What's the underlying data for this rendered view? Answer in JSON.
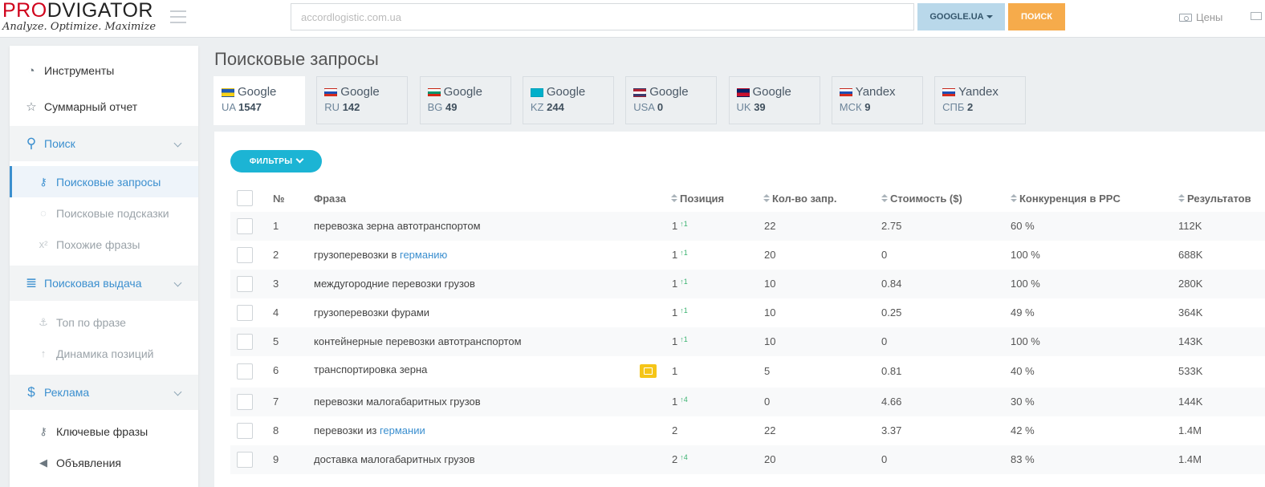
{
  "header": {
    "logo_pro": "PRO",
    "logo_rest": "DVIGATOR",
    "tagline": "Analyze. Optimize. Maximize",
    "search_value": "accordlogistic.com.ua",
    "engine_label": "GOOGLE.UA",
    "search_button": "ПОИСК",
    "prices_label": "Цены"
  },
  "sidebar": {
    "items": [
      {
        "label": "Инструменты",
        "icon": "dashboard-icon",
        "kind": "item"
      },
      {
        "label": "Суммарный отчет",
        "icon": "star-icon",
        "kind": "item"
      },
      {
        "label": "Поиск",
        "icon": "search-icon",
        "kind": "section"
      },
      {
        "label": "Поисковые запросы",
        "icon": "key-icon",
        "kind": "active"
      },
      {
        "label": "Поисковые подсказки",
        "icon": "comments-icon",
        "kind": "muted"
      },
      {
        "label": "Похожие фразы",
        "icon": "superscript-icon",
        "kind": "muted"
      },
      {
        "label": "Поисковая выдача",
        "icon": "database-icon",
        "kind": "section"
      },
      {
        "label": "Топ по фразе",
        "icon": "anchor-icon",
        "kind": "muted"
      },
      {
        "label": "Динамика позиций",
        "icon": "arrow-up-icon",
        "kind": "muted"
      },
      {
        "label": "Реклама",
        "icon": "dollar-icon",
        "kind": "section"
      },
      {
        "label": "Ключевые фразы",
        "icon": "key-icon",
        "kind": "sub"
      },
      {
        "label": "Объявления",
        "icon": "bullhorn-icon",
        "kind": "sub"
      }
    ]
  },
  "main": {
    "title": "Поисковые запросы",
    "tabs": [
      {
        "engine": "Google",
        "region": "UA",
        "count": "1547",
        "flag": [
          "#1e5bb8",
          "#f7d117"
        ]
      },
      {
        "engine": "Google",
        "region": "RU",
        "count": "142",
        "flag": [
          "#ffffff",
          "#1d4fb5",
          "#d52b1e"
        ]
      },
      {
        "engine": "Google",
        "region": "BG",
        "count": "49",
        "flag": [
          "#ffffff",
          "#00966e",
          "#d62612"
        ]
      },
      {
        "engine": "Google",
        "region": "KZ",
        "count": "244",
        "flag": [
          "#00afca"
        ]
      },
      {
        "engine": "Google",
        "region": "USA",
        "count": "0",
        "flag": [
          "#b22234",
          "#ffffff",
          "#3c3b6e"
        ]
      },
      {
        "engine": "Google",
        "region": "UK",
        "count": "39",
        "flag": [
          "#012169",
          "#c8102e"
        ]
      },
      {
        "engine": "Yandex",
        "region": "МСК",
        "count": "9",
        "flag": [
          "#ffffff",
          "#1d4fb5",
          "#d52b1e"
        ]
      },
      {
        "engine": "Yandex",
        "region": "СПБ",
        "count": "2",
        "flag": [
          "#ffffff",
          "#1d4fb5",
          "#d52b1e"
        ]
      }
    ],
    "filter_label": "ФИЛЬТРЫ",
    "columns": {
      "num": "№",
      "phrase": "Фраза",
      "position": "Позиция",
      "volume": "Кол-во запр.",
      "cost": "Стоимость ($)",
      "competition": "Конкуренция в PPC",
      "results": "Результатов"
    },
    "rows": [
      {
        "num": "1",
        "phrase": "перевозка зерна автотранспортом",
        "phrase_link": "",
        "position": "1",
        "delta": "↑1",
        "volume": "22",
        "cost": "2.75",
        "competition": "60 %",
        "results": "112K",
        "image": false
      },
      {
        "num": "2",
        "phrase": "грузоперевозки в ",
        "phrase_link": "германию",
        "position": "1",
        "delta": "↑1",
        "volume": "20",
        "cost": "0",
        "competition": "100 %",
        "results": "688K",
        "image": false
      },
      {
        "num": "3",
        "phrase": "междугородние перевозки грузов",
        "phrase_link": "",
        "position": "1",
        "delta": "↑1",
        "volume": "10",
        "cost": "0.84",
        "competition": "100 %",
        "results": "280K",
        "image": false
      },
      {
        "num": "4",
        "phrase": "грузоперевозки фурами",
        "phrase_link": "",
        "position": "1",
        "delta": "↑1",
        "volume": "10",
        "cost": "0.25",
        "competition": "49 %",
        "results": "364K",
        "image": false
      },
      {
        "num": "5",
        "phrase": "контейнерные перевозки автотранспортом",
        "phrase_link": "",
        "position": "1",
        "delta": "↑1",
        "volume": "10",
        "cost": "0",
        "competition": "100 %",
        "results": "143K",
        "image": false
      },
      {
        "num": "6",
        "phrase": "транспортировка зерна",
        "phrase_link": "",
        "position": "1",
        "delta": "",
        "volume": "5",
        "cost": "0.81",
        "competition": "40 %",
        "results": "533K",
        "image": true
      },
      {
        "num": "7",
        "phrase": "перевозки малогабаритных грузов",
        "phrase_link": "",
        "position": "1",
        "delta": "↑4",
        "volume": "0",
        "cost": "4.66",
        "competition": "30 %",
        "results": "144K",
        "image": false
      },
      {
        "num": "8",
        "phrase": "перевозки из ",
        "phrase_link": "германии",
        "position": "2",
        "delta": "",
        "volume": "22",
        "cost": "3.37",
        "competition": "42 %",
        "results": "1.4M",
        "image": false
      },
      {
        "num": "9",
        "phrase": "доставка малогабаритных грузов",
        "phrase_link": "",
        "position": "2",
        "delta": "↑4",
        "volume": "20",
        "cost": "0",
        "competition": "83 %",
        "results": "1.4M",
        "image": false
      }
    ]
  }
}
